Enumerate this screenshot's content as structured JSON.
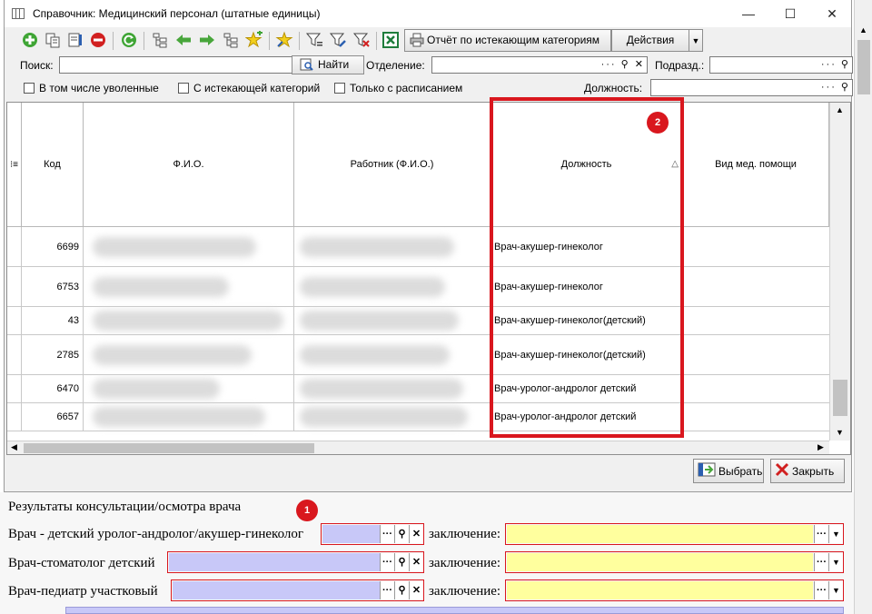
{
  "window": {
    "title": "Справочник: Медицинский персонал (штатные единицы)",
    "minimize": "—",
    "maximize": "☐",
    "close": "✕"
  },
  "toolbar": {
    "report_button": "Отчёт по истекающим категориям",
    "actions_button": "Действия",
    "icons": [
      "add-icon",
      "copy-icon",
      "edit-icon",
      "delete-icon",
      "refresh-icon",
      "tree-icon",
      "arrow-left-icon",
      "arrow-right-icon",
      "tree-move-icon",
      "star-add-icon",
      "star-icon",
      "filter-icon",
      "filter-edit-icon",
      "filter-clear-icon",
      "excel-icon",
      "printer-icon"
    ]
  },
  "search": {
    "label": "Поиск:",
    "value": "",
    "find_button": "Найти",
    "department_label": "Отделение:",
    "department_value": "",
    "subdivision_label": "Подразд.:",
    "subdivision_value": "",
    "position_label": "Должность:",
    "position_value": "",
    "dots": "···"
  },
  "filters": {
    "include_fired": "В том числе уволенные",
    "expiring_category": "С истекающей категорий",
    "schedule_only": "Только с расписанием"
  },
  "grid": {
    "columns": [
      "Код",
      "Ф.И.О.",
      "Работник (Ф.И.О.)",
      "Должность",
      "Вид мед. помощи"
    ],
    "sort_indicator": "△",
    "rows": [
      {
        "code": "6699",
        "position": "Врач-акушер-гинеколог"
      },
      {
        "code": "6753",
        "position": "Врач-акушер-гинеколог"
      },
      {
        "code": "43",
        "position": "Врач-акушер-гинеколог(детский)"
      },
      {
        "code": "2785",
        "position": "Врач-акушер-гинеколог(детский)"
      },
      {
        "code": "6470",
        "position": "Врач-уролог-андролог детский"
      },
      {
        "code": "6657",
        "position": "Врач-уролог-андролог детский"
      }
    ]
  },
  "buttons": {
    "select": "Выбрать",
    "close": "Закрыть"
  },
  "markers": {
    "m1": "1",
    "m2": "2"
  },
  "form": {
    "section_title": "Результаты консультации/осмотра врача",
    "conclusion_label": "заключение:",
    "doctors": [
      "Врач - детский уролог-андролог/акушер-гинеколог",
      "Врач-стоматолог детский",
      "Врач-педиатр участковый"
    ]
  },
  "colors": {
    "highlight_red": "#d9171e",
    "doctor_field": "#c8c8f8",
    "conclusion_field": "#ffff9e"
  }
}
